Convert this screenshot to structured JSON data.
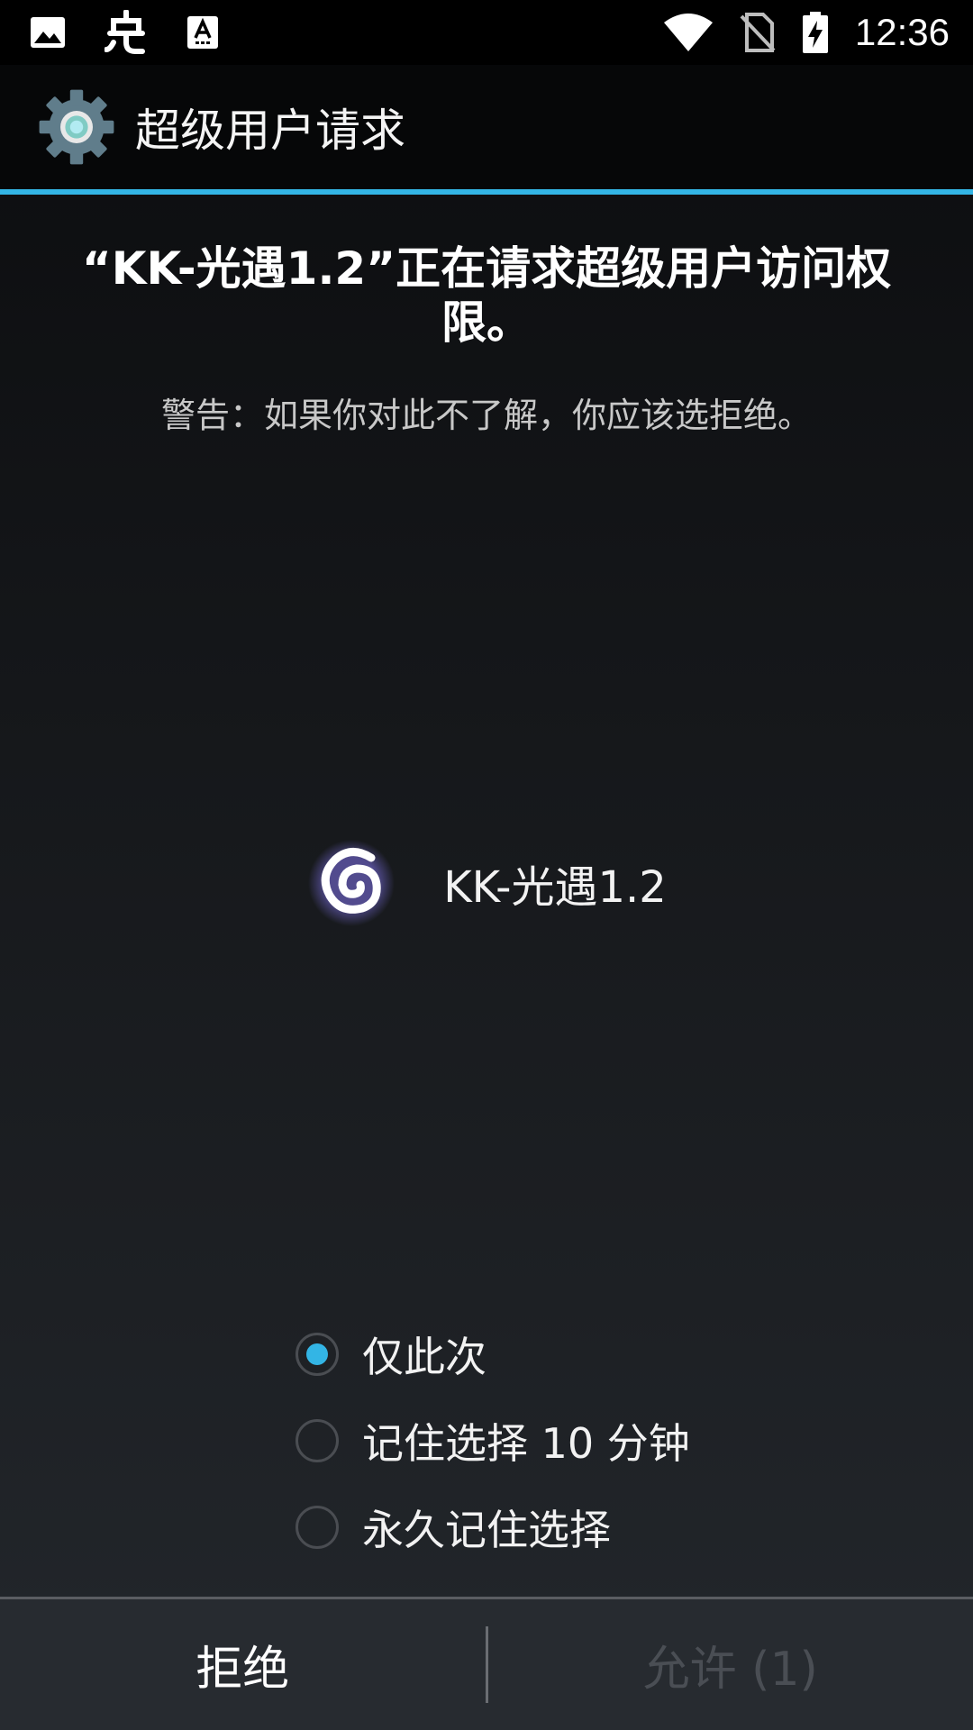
{
  "status_bar": {
    "time": "12:36",
    "icons": [
      "image-icon",
      "bug-icon",
      "keyboard-a-icon",
      "wifi-icon",
      "no-sim-icon",
      "battery-charging-icon"
    ]
  },
  "app_bar": {
    "title": "超级用户请求",
    "icon": "gear-icon",
    "accent_color": "#33b5e5"
  },
  "request": {
    "title": "“KK-光遇1.2”正在请求超级用户访问权限。",
    "warning": "警告：如果你对此不了解，你应该选拒绝。"
  },
  "app": {
    "name": "KK-光遇1.2",
    "icon": "spiral-icon"
  },
  "options": [
    {
      "label": "仅此次",
      "checked": true
    },
    {
      "label": "记住选择 10 分钟",
      "checked": false
    },
    {
      "label": "永久记住选择",
      "checked": false
    }
  ],
  "buttons": {
    "deny": "拒绝",
    "allow": "允许 (1)"
  }
}
